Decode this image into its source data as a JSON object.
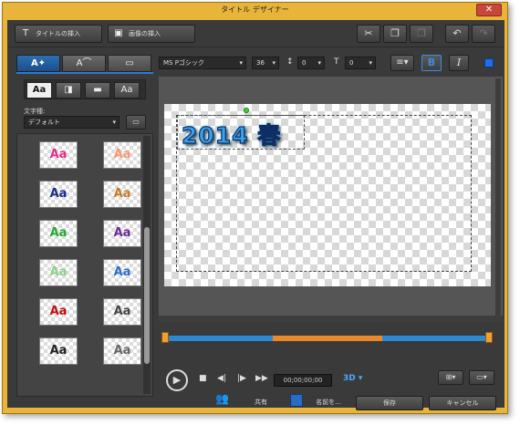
{
  "window": {
    "title": "タイトル デザイナー",
    "close_label": "✕"
  },
  "toolbar": {
    "insert_title_label": "タイトルの挿入",
    "insert_image_label": "画像の挿入"
  },
  "left_panel": {
    "tabs": [
      "A✦",
      "A⌒",
      "▭"
    ],
    "style_buttons": [
      "Aa",
      "",
      "",
      "Aa"
    ],
    "font_style_label": "文字種:",
    "font_style_value": "デフォルト",
    "presets": [
      {
        "label": "Aa",
        "color": "#e0308a"
      },
      {
        "label": "Aa",
        "color": "#f29b6e"
      },
      {
        "label": "Aa",
        "color": "#1a2a8a"
      },
      {
        "label": "Aa",
        "color": "#c87a2a"
      },
      {
        "label": "Aa",
        "color": "#26a832"
      },
      {
        "label": "Aa",
        "color": "#6a2a9a"
      },
      {
        "label": "Aa",
        "color": "#8fcf8f"
      },
      {
        "label": "Aa",
        "color": "#2a6fc8"
      },
      {
        "label": "Aa",
        "color": "#c01010"
      },
      {
        "label": "Aa",
        "color": "#444444"
      },
      {
        "label": "Aa",
        "color": "#222222"
      },
      {
        "label": "Aa",
        "color": "#666666"
      }
    ]
  },
  "font_bar": {
    "font_name": "MS Pゴシック",
    "font_size": "36",
    "line_spacing": "0",
    "char_spacing": "0",
    "bold": "B",
    "italic": "I"
  },
  "canvas": {
    "title_text": "2014 春"
  },
  "player": {
    "timecode": "00;00;00;00",
    "mode_3d": "3D"
  },
  "bottom": {
    "share_label": "共有",
    "save_as_label": "名前を...",
    "save_label": "保存",
    "cancel_label": "キャンセル"
  },
  "colors": {
    "accent": "#2d7bcf",
    "frame": "#e8b53a",
    "title_fill": "#3ba0e8"
  }
}
